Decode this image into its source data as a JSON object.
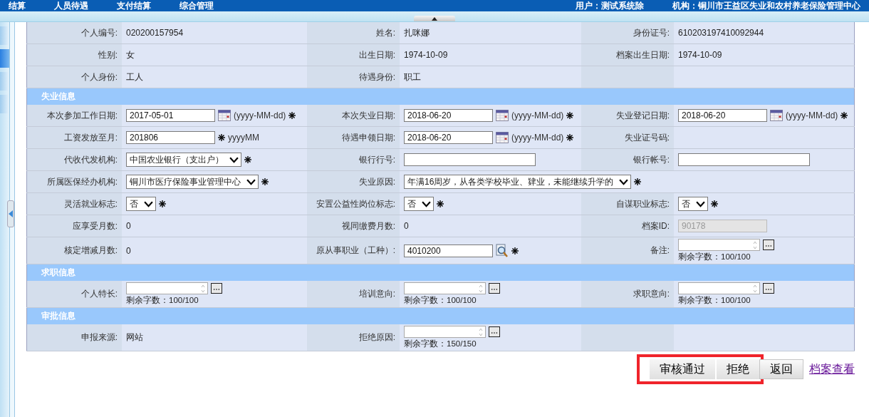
{
  "top_bar": {
    "menu": [
      "结算",
      "人员待遇",
      "支付结算",
      "综合管理"
    ],
    "user": "用户：测试系统除",
    "org": "机构：铜川市王益区失业和农村养老保险管理中心"
  },
  "sections": [
    {
      "rows": [
        {
          "cells": [
            {
              "label": "个人编号:",
              "kind": "text",
              "value": "020200157954"
            },
            {
              "label": "姓名:",
              "kind": "text",
              "value": "扎咪娜"
            },
            {
              "label": "身份证号:",
              "kind": "text",
              "value": "610203197410092944"
            }
          ]
        },
        {
          "cells": [
            {
              "label": "性别:",
              "kind": "text",
              "value": "女"
            },
            {
              "label": "出生日期:",
              "kind": "text",
              "value": "1974-10-09"
            },
            {
              "label": "档案出生日期:",
              "kind": "text",
              "value": "1974-10-09"
            }
          ]
        },
        {
          "cells": [
            {
              "label": "个人身份:",
              "kind": "text",
              "value": "工人"
            },
            {
              "label": "待遇身份:",
              "kind": "text",
              "value": "职工"
            },
            {
              "kind": "blank"
            }
          ]
        }
      ]
    },
    {
      "title": "失业信息",
      "rows": [
        {
          "cells": [
            {
              "label": "本次参加工作日期:",
              "kind": "date",
              "value": "2017-05-01",
              "hint": "(yyyy-MM-dd)",
              "required": true
            },
            {
              "label": "本次失业日期:",
              "kind": "date",
              "value": "2018-06-20",
              "hint": "(yyyy-MM-dd)",
              "required": true
            },
            {
              "label": "失业登记日期:",
              "kind": "date",
              "value": "2018-06-20",
              "hint": "(yyyy-MM-dd)",
              "required": true
            }
          ]
        },
        {
          "cells": [
            {
              "label": "工资发放至月:",
              "kind": "input",
              "value": "201806",
              "hint": "yyyyMM",
              "required": true
            },
            {
              "label": "待遇申领日期:",
              "kind": "date",
              "value": "2018-06-20",
              "hint": "(yyyy-MM-dd)",
              "required": true
            },
            {
              "label": "失业证号码:",
              "kind": "blank"
            }
          ]
        },
        {
          "cells": [
            {
              "label": "代收代发机构:",
              "kind": "select",
              "value": "中国农业银行（支出户）",
              "required": true
            },
            {
              "label": "银行行号:",
              "kind": "input"
            },
            {
              "label": "银行帐号:",
              "kind": "input"
            }
          ]
        },
        {
          "cells": [
            {
              "label": "所属医保经办机构:",
              "kind": "select",
              "value": "铜川市医疗保险事业管理中心",
              "required": true
            },
            {
              "label": "失业原因:",
              "kind": "select",
              "value": "年满16周岁，从各类学校毕业、肄业，未能继续升学的",
              "required": true
            }
          ]
        },
        {
          "cells": [
            {
              "label": "灵活就业标志:",
              "kind": "select",
              "value": "否",
              "required": true
            },
            {
              "label": "安置公益性岗位标志:",
              "kind": "select",
              "value": "否",
              "required": true
            },
            {
              "label": "自谋职业标志:",
              "kind": "select",
              "value": "否",
              "required": true
            }
          ]
        },
        {
          "cells": [
            {
              "label": "应享受月数:",
              "kind": "text",
              "value": "0"
            },
            {
              "label": "视同缴费月数:",
              "kind": "text",
              "value": "0"
            },
            {
              "label": "档案ID:",
              "kind": "input",
              "value": "90178",
              "disabled": true
            }
          ]
        },
        {
          "cells": [
            {
              "label": "核定增减月数:",
              "kind": "text",
              "value": "0"
            },
            {
              "label": "原从事职业（工种）:",
              "kind": "lookup",
              "value": "4010200",
              "required": true
            },
            {
              "label": "备注:",
              "kind": "textarea",
              "counter": "剩余字数：100/100"
            }
          ]
        }
      ]
    },
    {
      "title": "求职信息",
      "rows": [
        {
          "cells": [
            {
              "label": "个人特长:",
              "kind": "textarea",
              "counter": "剩余字数：100/100"
            },
            {
              "label": "培训意向:",
              "kind": "textarea",
              "counter": "剩余字数：100/100"
            },
            {
              "label": "求职意向:",
              "kind": "textarea",
              "counter": "剩余字数：100/100"
            }
          ]
        }
      ]
    },
    {
      "title": "审批信息",
      "rows": [
        {
          "cells": [
            {
              "label": "申报来源:",
              "kind": "text",
              "value": "网站"
            },
            {
              "label": "拒绝原因:",
              "kind": "textarea",
              "counter": "剩余字数：150/150"
            },
            {
              "kind": "blank"
            }
          ]
        }
      ]
    }
  ],
  "actions": [
    {
      "label": "审核通过",
      "kind": "button",
      "highlighted": true
    },
    {
      "label": "拒绝",
      "kind": "button",
      "highlighted": true
    },
    {
      "label": "返回",
      "kind": "button",
      "highlighted": false
    },
    {
      "label": "档案查看",
      "kind": "link",
      "highlighted": false
    }
  ]
}
